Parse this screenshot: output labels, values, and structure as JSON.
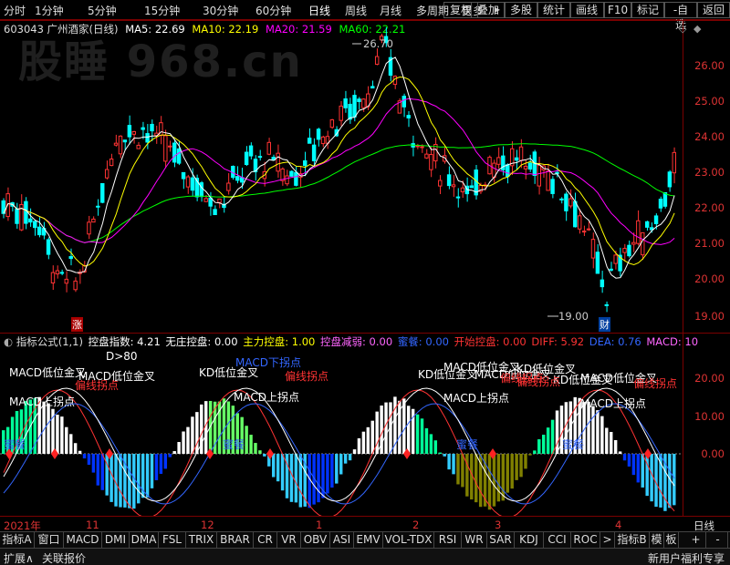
{
  "toolbar": {
    "periods": [
      "分时",
      "1分钟",
      "5分钟",
      "15分钟",
      "30分钟",
      "60分钟",
      "日线",
      "周线",
      "月线",
      "多周期",
      "更多"
    ],
    "more_arrow": "▸",
    "buttons": [
      "复权",
      "叠加",
      "多股",
      "统计",
      "画线",
      "F10",
      "标记",
      "-自选",
      "返回"
    ]
  },
  "stock": {
    "code_name": "603043 广州酒家(日线)",
    "ma5": "MA5: 22.69",
    "ma10": "MA10: 22.19",
    "ma20": "MA20: 21.59",
    "ma60": "MA60: 22.21",
    "high_label": "26.70",
    "low_label": "19.00",
    "tag_zhang": "涨",
    "tag_cai": "财",
    "watermark": "股睡 968.cn"
  },
  "colors": {
    "up": "#ff3333",
    "down": "#00ffff",
    "ma5": "#ffffff",
    "ma10": "#ffff00",
    "ma20": "#ff00ff",
    "ma60": "#00ff00"
  },
  "price_axis": [
    "26.00",
    "25.00",
    "24.00",
    "23.00",
    "22.00",
    "21.00",
    "20.00",
    "19.00"
  ],
  "indicator": {
    "title": "指标公式(1,1)",
    "items": [
      {
        "label": "控盘指数: 4.21",
        "color": "#ffffff"
      },
      {
        "label": "无庄控盘: 0.00",
        "color": "#ffffff"
      },
      {
        "label": "主力控盘: 1.00",
        "color": "#ffff00"
      },
      {
        "label": "控盘减弱: 0.00",
        "color": "#ff66ff"
      },
      {
        "label": "蜜餐: 0.00",
        "color": "#3366ff"
      },
      {
        "label": "开始控盘: 0.00",
        "color": "#ff3333"
      },
      {
        "label": "DIFF: 5.92",
        "color": "#ff3333"
      },
      {
        "label": "DEA: 0.76",
        "color": "#3366ff"
      },
      {
        "label": "MACD: 10",
        "color": "#ff66ff"
      }
    ],
    "axis": [
      "20.00",
      "10.00",
      "0.00"
    ],
    "annotations": [
      {
        "text": "D>80",
        "color": "#ffffff"
      },
      {
        "text": "MACD低位金叉",
        "color": "#ffffff"
      },
      {
        "text": "MACD低位金叉",
        "color": "#ffffff"
      },
      {
        "text": "MACD下拐点",
        "color": "#3366ff"
      },
      {
        "text": "KD低位金叉",
        "color": "#ffffff"
      },
      {
        "text": "MACD低位金叉",
        "color": "#ffffff"
      },
      {
        "text": "KD低位金叉",
        "color": "#ffffff"
      },
      {
        "text": "KD低位金叉",
        "color": "#ffffff"
      },
      {
        "text": "MACD低位金叉",
        "color": "#ffffff"
      },
      {
        "text": "KD低位金叉",
        "color": "#ffffff"
      },
      {
        "text": "MACD低位金叉",
        "color": "#ffffff"
      },
      {
        "text": "MACD上拐点",
        "color": "#ffffff"
      },
      {
        "text": "MACD上拐点",
        "color": "#ffffff"
      },
      {
        "text": "MACD上拐点",
        "color": "#ffffff"
      },
      {
        "text": "MACD上拐点",
        "color": "#ffffff"
      },
      {
        "text": "偏线拐点",
        "color": "#ff3333"
      },
      {
        "text": "偏线拐点",
        "color": "#ff3333"
      },
      {
        "text": "偏线拐点",
        "color": "#ff3333"
      },
      {
        "text": "偏线拐点",
        "color": "#ff3333"
      },
      {
        "text": "偏线拐点",
        "color": "#ff3333"
      },
      {
        "text": "蜜餐",
        "color": "#3366ff"
      },
      {
        "text": "蜜餐",
        "color": "#3366ff"
      },
      {
        "text": "蜜餐",
        "color": "#3366ff"
      },
      {
        "text": "蜜餐",
        "color": "#3366ff"
      }
    ]
  },
  "xaxis": {
    "labels": [
      "2021年",
      "11",
      "12",
      "1",
      "2",
      "3",
      "4"
    ],
    "period": "日线"
  },
  "tabs": [
    "指标A",
    "窗口",
    "MACD",
    "DMI",
    "DMA",
    "FSL",
    "TRIX",
    "BRAR",
    "CR",
    "VR",
    "OBV",
    "ASI",
    "EMV",
    "VOL-TDX",
    "RSI",
    "WR",
    "SAR",
    "KDJ",
    "CCI",
    "ROC",
    ">",
    "指标B",
    "模",
    "板",
    "+",
    "-"
  ],
  "status": {
    "left": [
      "扩展∧",
      "关联报价"
    ],
    "right": "新用户福利专享"
  }
}
